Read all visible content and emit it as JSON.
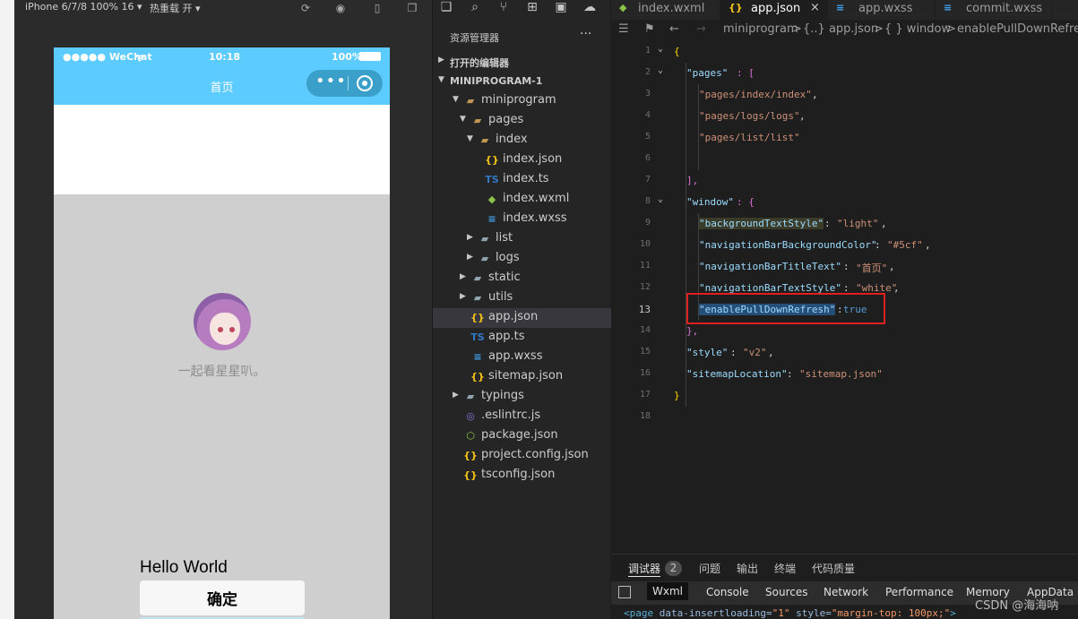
{
  "simulator": {
    "device_label": "iPhone 6/7/8 100% 16 ▾",
    "hot_reload_label": "热重载 开 ▾",
    "phone": {
      "carrier": "●●●●● WeChat",
      "wifi": "ᯤ",
      "time": "10:18",
      "battery_pct": "100%",
      "nav_title": "首页",
      "nav_bar_color": "#5ccbff",
      "capsule_menu": "•••",
      "motto": "一起看星星叭。",
      "hello_text": "Hello World",
      "confirm_label": "确定"
    }
  },
  "explorer": {
    "title": "资源管理器",
    "more": "···",
    "open_editors": "打开的编辑器",
    "project": "MINIPROGRAM-1",
    "tree": [
      {
        "label": "miniprogram",
        "icon": "folder-open-icon",
        "expanded": true
      },
      {
        "label": "pages",
        "icon": "folder-open-icon",
        "expanded": true
      },
      {
        "label": "index",
        "icon": "folder-open-icon",
        "expanded": true
      },
      {
        "label": "index.json",
        "icon": "json-icon"
      },
      {
        "label": "index.ts",
        "icon": "typescript-icon"
      },
      {
        "label": "index.wxml",
        "icon": "wxml-icon"
      },
      {
        "label": "index.wxss",
        "icon": "css-icon"
      },
      {
        "label": "list",
        "icon": "folder-icon",
        "expanded": false
      },
      {
        "label": "logs",
        "icon": "folder-icon",
        "expanded": false
      },
      {
        "label": "static",
        "icon": "folder-icon",
        "expanded": false
      },
      {
        "label": "utils",
        "icon": "folder-icon",
        "expanded": false
      },
      {
        "label": "app.json",
        "icon": "json-icon",
        "selected": true
      },
      {
        "label": "app.ts",
        "icon": "typescript-icon"
      },
      {
        "label": "app.wxss",
        "icon": "css-icon"
      },
      {
        "label": "sitemap.json",
        "icon": "json-icon"
      },
      {
        "label": "typings",
        "icon": "folder-icon",
        "expanded": false
      },
      {
        "label": ".eslintrc.js",
        "icon": "eslint-icon"
      },
      {
        "label": "package.json",
        "icon": "npm-icon"
      },
      {
        "label": "project.config.json",
        "icon": "json-icon"
      },
      {
        "label": "tsconfig.json",
        "icon": "json-icon"
      }
    ]
  },
  "editor": {
    "tabs": [
      {
        "label": "index.wxml",
        "icon": "wxml-icon"
      },
      {
        "label": "app.json",
        "icon": "json-icon",
        "active": true
      },
      {
        "label": "app.wxss",
        "icon": "css-icon"
      },
      {
        "label": "commit.wxss",
        "icon": "css-icon"
      }
    ],
    "close_glyph": "×",
    "breadcrumb": [
      "miniprogram",
      ">",
      "{..} app.json",
      ">",
      "{ } window",
      ">",
      "enablePullDownRefresh"
    ],
    "current_line": "13",
    "lines": [
      "1",
      "2",
      "3",
      "4",
      "5",
      "6",
      "7",
      "8",
      "9",
      "10",
      "11",
      "12",
      "13",
      "14",
      "15",
      "16",
      "17",
      "18"
    ],
    "code": {
      "l1": "{",
      "l2_key": "\"pages\"",
      "l2_rest": ": [",
      "l3": "\"pages/index/index\"",
      "l3_comma": ",",
      "l4": "\"pages/logs/logs\"",
      "l4_comma": ",",
      "l5": "\"pages/list/list\"",
      "l7": "],",
      "l8_key": "\"window\"",
      "l8_rest": ": {",
      "l9_key": "\"backgroundTextStyle\"",
      "l9_colon": ": ",
      "l9_val": "\"light\"",
      "l9_comma": ",",
      "l10_key": "\"navigationBarBackgroundColor\"",
      "l10_colon": ": ",
      "l10_val": "\"#5cf\"",
      "l10_comma": ",",
      "l11_key": "\"navigationBarTitleText\"",
      "l11_colon": ": ",
      "l11_val": "\"首页\"",
      "l11_comma": ",",
      "l12_key": "\"navigationBarTextStyle\"",
      "l12_colon": ": ",
      "l12_val": "\"white\"",
      "l12_comma": ",",
      "l13_key": "\"enablePullDownRefresh\"",
      "l13_colon": ":",
      "l13_val": "true",
      "l14": "},",
      "l15_key": "\"style\"",
      "l15_colon": ": ",
      "l15_val": "\"v2\"",
      "l15_comma": ",",
      "l16_key": "\"sitemapLocation\"",
      "l16_colon": ": ",
      "l16_val": "\"sitemap.json\"",
      "l17": "}"
    }
  },
  "debug": {
    "tabs": [
      "调试器",
      "问题",
      "输出",
      "终端",
      "代码质量"
    ],
    "badge": "2",
    "devtools_tabs": [
      "Wxml",
      "Console",
      "Sources",
      "Network",
      "Performance",
      "Memory",
      "AppData"
    ],
    "dom_tag_open": "<page",
    "dom_attr1": " data-insertloading=",
    "dom_val1": "\"1\"",
    "dom_attr2": " style=",
    "dom_val2": "\"margin-top: 100px;\"",
    "dom_tag_close": ">"
  },
  "watermark": "CSDN @海海呐"
}
